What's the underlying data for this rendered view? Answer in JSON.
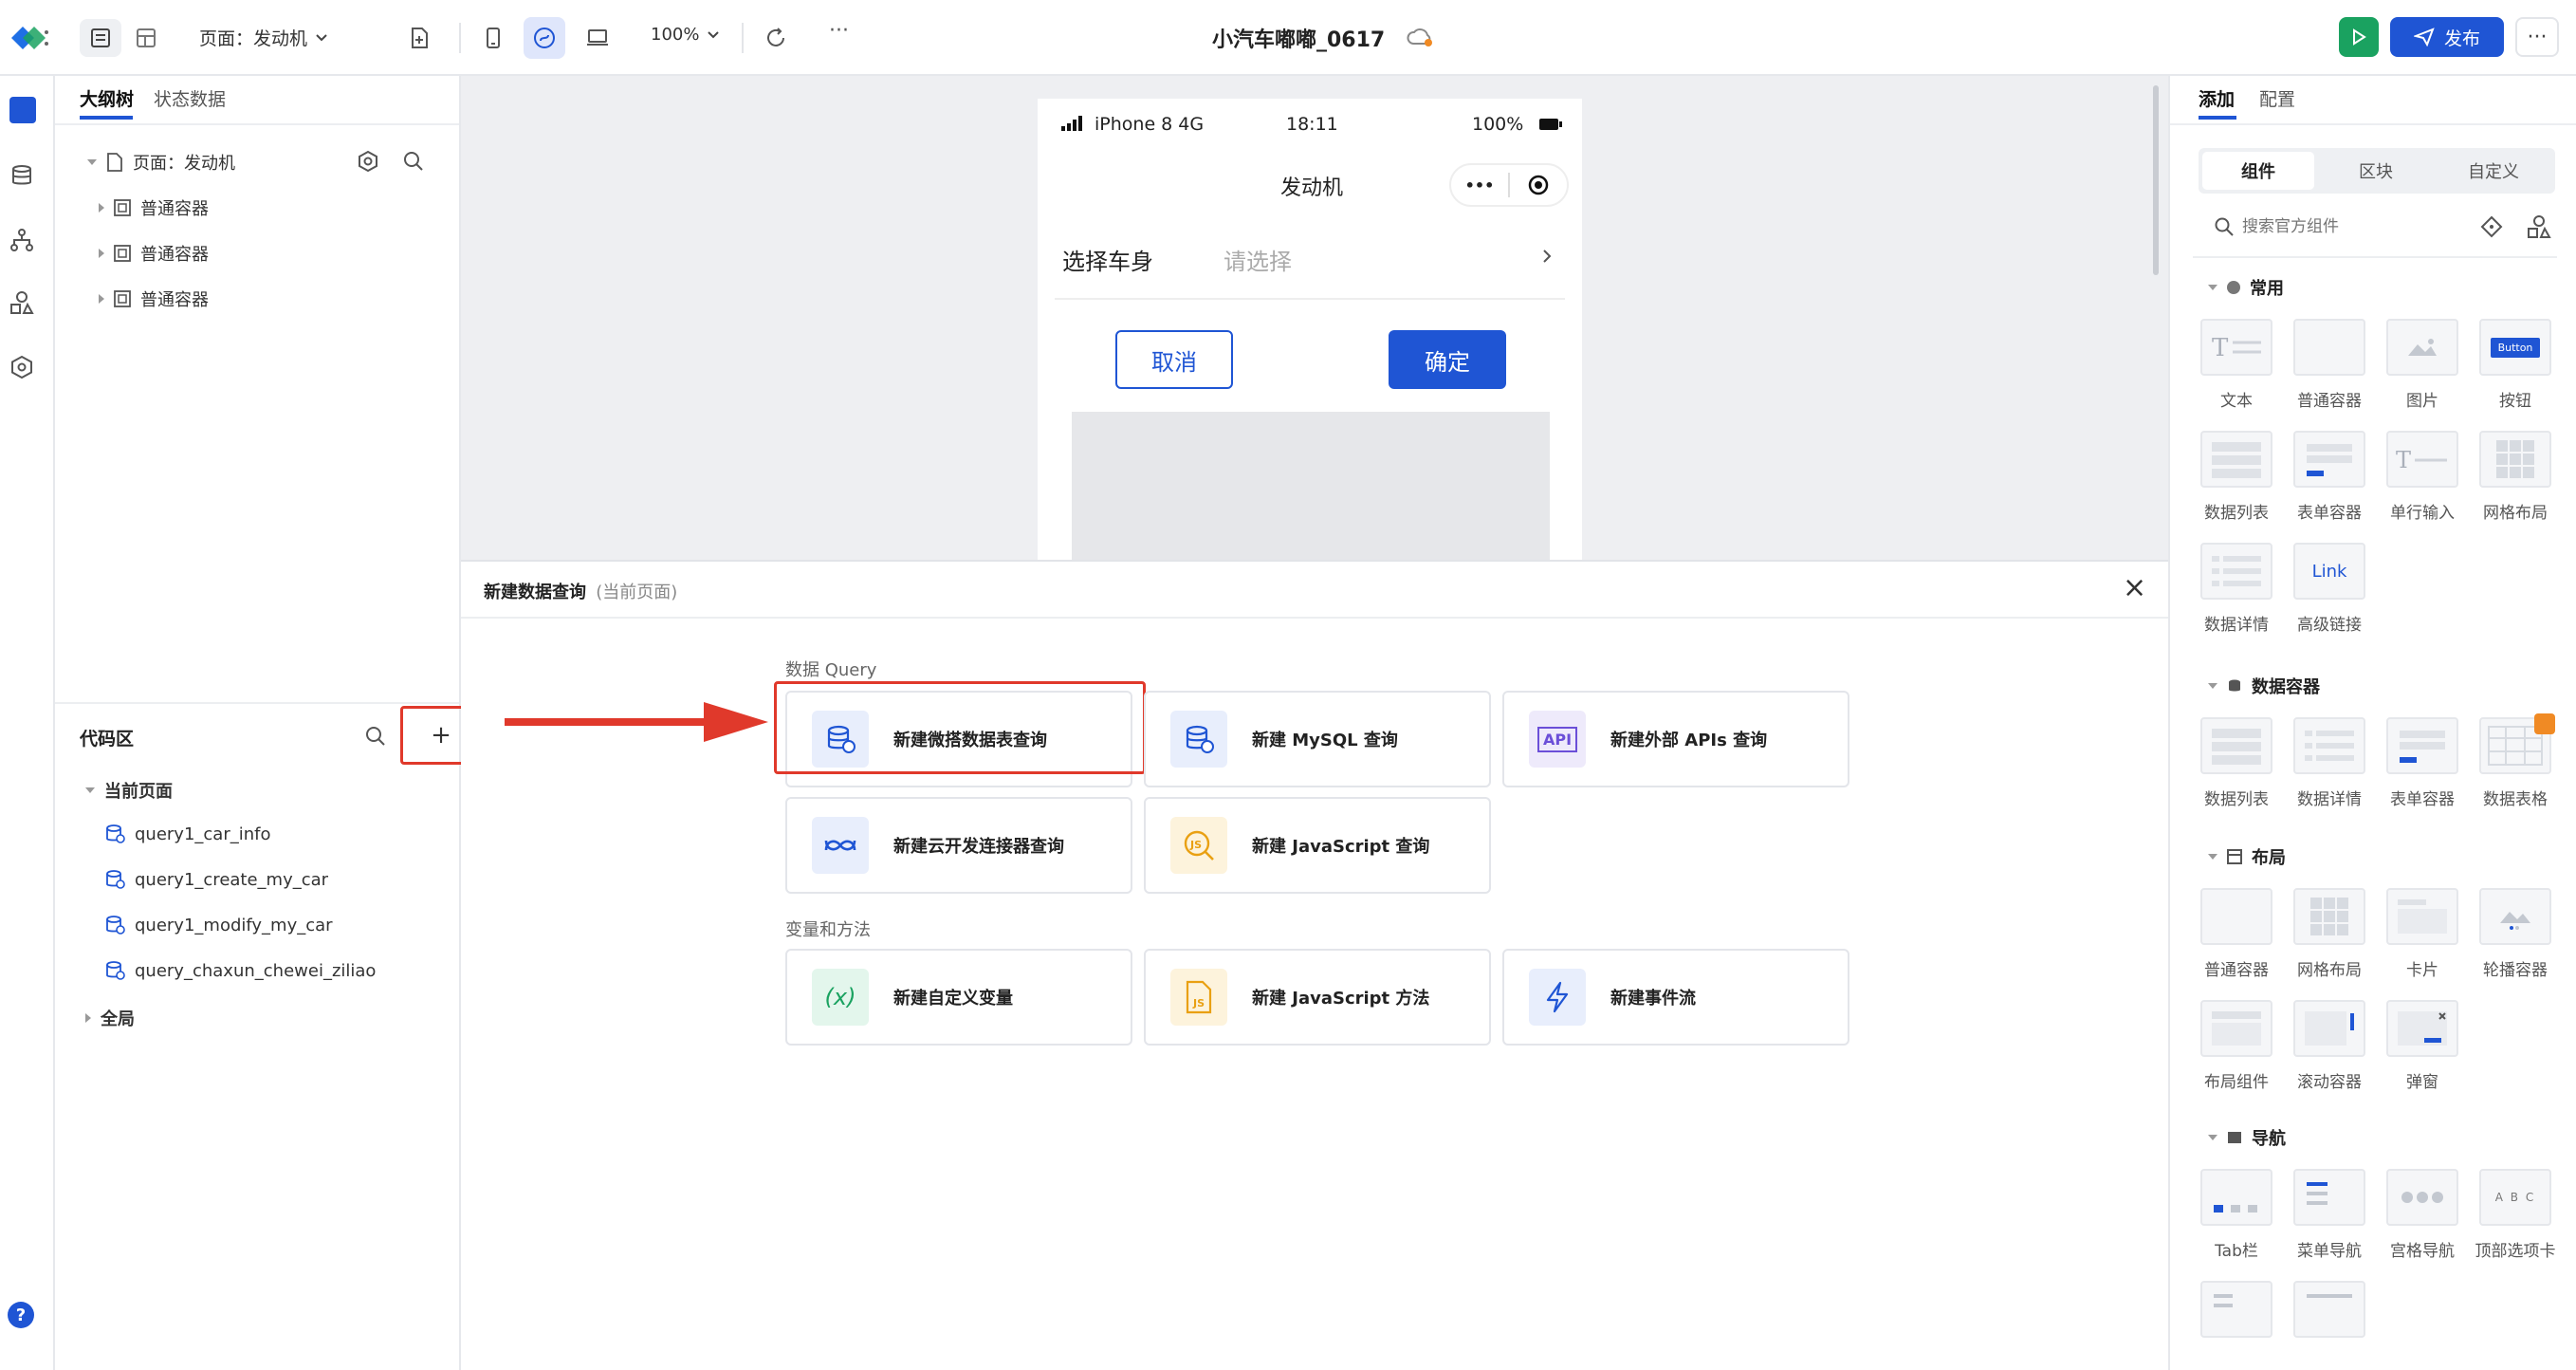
{
  "topbar": {
    "page_label": "页面：发动机",
    "zoom": "100%",
    "app_title": "小汽车嘟嘟_0617",
    "publish_label": "发布",
    "more": "···"
  },
  "outline": {
    "tabs": [
      "大纲树",
      "状态数据"
    ],
    "page_node": "页面：发动机",
    "containers": [
      "普通容器",
      "普通容器",
      "普通容器"
    ]
  },
  "code_area": {
    "title": "代码区",
    "add": "+",
    "current_page": "当前页面",
    "queries": [
      "query1_car_info",
      "query1_create_my_car",
      "query1_modify_my_car",
      "query_chaxun_chewei_ziliao"
    ],
    "global": "全局"
  },
  "phone": {
    "status_device": "iPhone 8  4G",
    "status_time": "18:11",
    "status_battery": "100%",
    "nav_title": "发动机",
    "menu_dots": "•••",
    "field_label": "选择车身",
    "field_placeholder": "请选择",
    "cancel_label": "取消",
    "confirm_label": "确定"
  },
  "dialog": {
    "title": "新建数据查询",
    "subtitle": "(当前页面)",
    "close": "×",
    "section_query": "数据 Query",
    "section_vars": "变量和方法",
    "cards_query": [
      "新建微搭数据表查询",
      "新建 MySQL 查询",
      "新建外部 APIs 查询",
      "新建云开发连接器查询",
      "新建 JavaScript 查询"
    ],
    "cards_vars": [
      "新建自定义变量",
      "新建 JavaScript 方法",
      "新建事件流"
    ],
    "api_icon_text": "API",
    "js_icon_text": "JS",
    "var_icon_text": "(x)"
  },
  "right": {
    "tabs": [
      "添加",
      "配置"
    ],
    "segments": [
      "组件",
      "区块",
      "自定义"
    ],
    "search_placeholder": "搜索官方组件",
    "cat_common": "常用",
    "common_items": [
      "文本",
      "普通容器",
      "图片",
      "按钮",
      "数据列表",
      "表单容器",
      "单行输入",
      "网格布局",
      "数据详情",
      "高级链接"
    ],
    "button_thumb_text": "Button",
    "link_thumb_text": "Link",
    "cat_data": "数据容器",
    "data_items": [
      "数据列表",
      "数据详情",
      "表单容器",
      "数据表格"
    ],
    "cat_layout": "布局",
    "layout_items": [
      "普通容器",
      "网格布局",
      "卡片",
      "轮播容器",
      "布局组件",
      "滚动容器",
      "弹窗"
    ],
    "cat_nav": "导航",
    "nav_items": [
      "Tab栏",
      "菜单导航",
      "宫格导航",
      "顶部选项卡"
    ],
    "tab_thumb_text": "A B C"
  },
  "colors": {
    "primary": "#1f55d4",
    "green": "#1aa260",
    "highlight": "#e0392b"
  }
}
